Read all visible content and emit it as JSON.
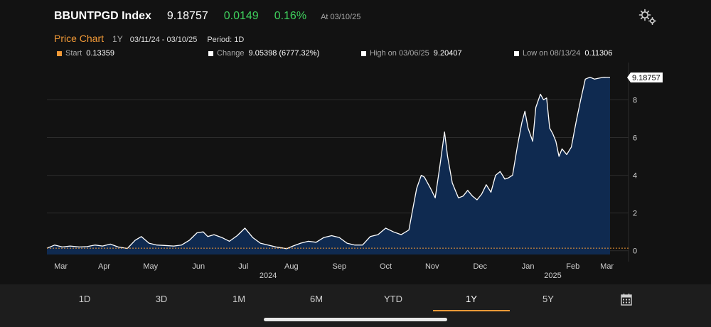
{
  "header": {
    "ticker": "BBUNTPGD Index",
    "last": "9.18757",
    "change": "0.0149",
    "change_pct": "0.16%",
    "as_of": "At 03/10/25",
    "settings_icon": "gear-icon"
  },
  "subheader": {
    "title": "Price Chart",
    "range": "1Y",
    "dates": "03/11/24 - 03/10/25",
    "period": "Period: 1D"
  },
  "stats": {
    "start_label": "Start",
    "start_value": "0.13359",
    "change_label": "Change",
    "change_value": "9.05398 (6777.32%)",
    "high_label": "High on 03/06/25",
    "high_value": "9.20407",
    "low_label": "Low on 08/13/24",
    "low_value": "0.11306"
  },
  "colors": {
    "up": "#3fd15d",
    "accent": "#f39a37",
    "area_fill": "#0f2a50",
    "line": "#ffffff"
  },
  "tabs": [
    "1D",
    "3D",
    "1M",
    "6M",
    "YTD",
    "1Y",
    "5Y"
  ],
  "active_tab": "1Y",
  "calendar_icon": "calendar-icon",
  "chart_data": {
    "type": "area",
    "ylim": [
      -0.2,
      9.6
    ],
    "yticks": [
      0,
      2,
      4,
      6,
      8
    ],
    "xlim": [
      "2024-03-11",
      "2025-03-10"
    ],
    "month_labels": [
      {
        "label": "Mar",
        "date": "2024-03-20"
      },
      {
        "label": "Apr",
        "date": "2024-04-17"
      },
      {
        "label": "May",
        "date": "2024-05-17"
      },
      {
        "label": "Jun",
        "date": "2024-06-17"
      },
      {
        "label": "Jul",
        "date": "2024-07-16"
      },
      {
        "label": "Aug",
        "date": "2024-08-16"
      },
      {
        "label": "Sep",
        "date": "2024-09-16"
      },
      {
        "label": "Oct",
        "date": "2024-10-16"
      },
      {
        "label": "Nov",
        "date": "2024-11-15"
      },
      {
        "label": "Dec",
        "date": "2024-12-16"
      },
      {
        "label": "Jan",
        "date": "2025-01-16"
      },
      {
        "label": "Feb",
        "date": "2025-02-14"
      },
      {
        "label": "Mar",
        "date": "2025-03-08"
      }
    ],
    "year_labels": [
      {
        "label": "2024",
        "date": "2024-08-01"
      },
      {
        "label": "2025",
        "date": "2025-02-01"
      }
    ],
    "start_value": 0.13359,
    "last_label": "9.18757",
    "last_value": 9.18757,
    "series": [
      {
        "x": [
          "2024-03-11",
          "2024-03-16",
          "2024-03-21",
          "2024-03-26",
          "2024-04-01",
          "2024-04-06",
          "2024-04-11",
          "2024-04-16",
          "2024-04-21",
          "2024-04-26",
          "2024-05-02",
          "2024-05-07",
          "2024-05-11",
          "2024-05-16",
          "2024-05-21",
          "2024-05-26",
          "2024-06-01",
          "2024-06-06",
          "2024-06-11",
          "2024-06-16",
          "2024-06-20",
          "2024-06-23",
          "2024-06-27",
          "2024-07-02",
          "2024-07-07",
          "2024-07-12",
          "2024-07-17",
          "2024-07-22",
          "2024-07-27",
          "2024-08-01",
          "2024-08-06",
          "2024-08-13",
          "2024-08-17",
          "2024-08-22",
          "2024-08-27",
          "2024-09-01",
          "2024-09-06",
          "2024-09-11",
          "2024-09-16",
          "2024-09-21",
          "2024-09-26",
          "2024-10-01",
          "2024-10-06",
          "2024-10-11",
          "2024-10-16",
          "2024-10-21",
          "2024-10-26",
          "2024-10-31",
          "2024-11-02",
          "2024-11-05",
          "2024-11-08",
          "2024-11-10",
          "2024-11-14",
          "2024-11-17",
          "2024-11-20",
          "2024-11-23",
          "2024-11-25",
          "2024-11-28",
          "2024-11-30",
          "2024-12-02",
          "2024-12-05",
          "2024-12-08",
          "2024-12-11",
          "2024-12-14",
          "2024-12-17",
          "2024-12-20",
          "2024-12-23",
          "2024-12-26",
          "2024-12-29",
          "2025-01-01",
          "2025-01-03",
          "2025-01-06",
          "2025-01-09",
          "2025-01-12",
          "2025-01-14",
          "2025-01-16",
          "2025-01-19",
          "2025-01-21",
          "2025-01-24",
          "2025-01-26",
          "2025-01-28",
          "2025-01-30",
          "2025-02-01",
          "2025-02-03",
          "2025-02-05",
          "2025-02-07",
          "2025-02-10",
          "2025-02-13",
          "2025-02-16",
          "2025-02-19",
          "2025-02-22",
          "2025-02-25",
          "2025-02-28",
          "2025-03-03",
          "2025-03-06",
          "2025-03-10"
        ],
        "values": [
          0.13,
          0.3,
          0.2,
          0.25,
          0.2,
          0.22,
          0.3,
          0.25,
          0.35,
          0.2,
          0.12,
          0.55,
          0.75,
          0.4,
          0.3,
          0.28,
          0.25,
          0.3,
          0.55,
          0.95,
          1.0,
          0.75,
          0.85,
          0.7,
          0.5,
          0.8,
          1.2,
          0.7,
          0.4,
          0.3,
          0.2,
          0.11,
          0.25,
          0.4,
          0.5,
          0.45,
          0.7,
          0.8,
          0.7,
          0.4,
          0.3,
          0.3,
          0.75,
          0.85,
          1.2,
          1.0,
          0.85,
          1.1,
          2.0,
          3.3,
          4.0,
          3.9,
          3.3,
          2.8,
          4.5,
          6.3,
          5.0,
          3.6,
          3.2,
          2.8,
          2.9,
          3.2,
          2.9,
          2.7,
          3.0,
          3.5,
          3.1,
          4.0,
          4.2,
          3.8,
          3.85,
          4.0,
          5.5,
          6.8,
          7.4,
          6.5,
          5.8,
          7.6,
          8.3,
          8.0,
          8.1,
          6.5,
          6.2,
          5.8,
          5.0,
          5.4,
          5.1,
          5.5,
          6.8,
          8.0,
          9.1,
          9.2,
          9.1,
          9.15,
          9.2,
          9.18757
        ]
      }
    ]
  }
}
